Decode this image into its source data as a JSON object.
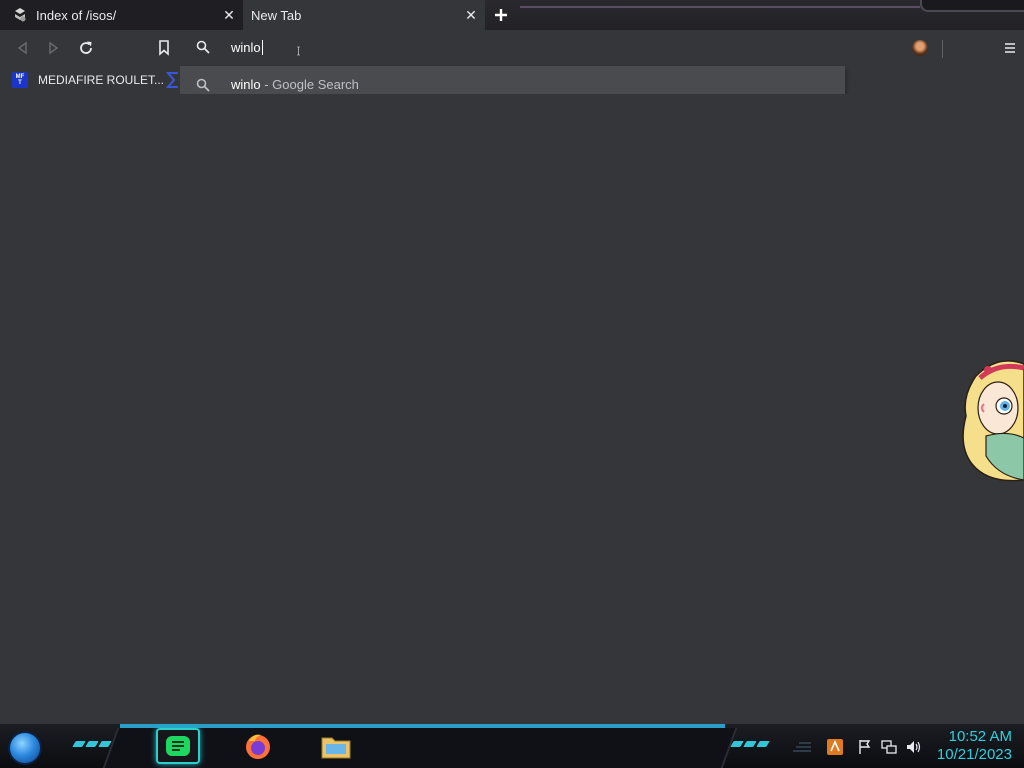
{
  "tabs": [
    {
      "title": "Index of /isos/",
      "state": "inactive"
    },
    {
      "title": "New Tab",
      "state": "active"
    }
  ],
  "omnibox": {
    "typed_text": "winlo"
  },
  "suggestions": [
    {
      "query": "winlo",
      "suffix": " - Google Search"
    }
  ],
  "bookmarks": [
    {
      "label": "MEDIAFIRE ROULET...",
      "icon_text_top": "MF",
      "icon_text_bottom": "T"
    }
  ],
  "clock": {
    "time": "10:52 AM",
    "date": "10/21/2023"
  },
  "colors": {
    "accent_cyan": "#2bd0e0",
    "taskbar_glow": "#2a9ec8",
    "bookmark_icon": "#1a35c8"
  }
}
